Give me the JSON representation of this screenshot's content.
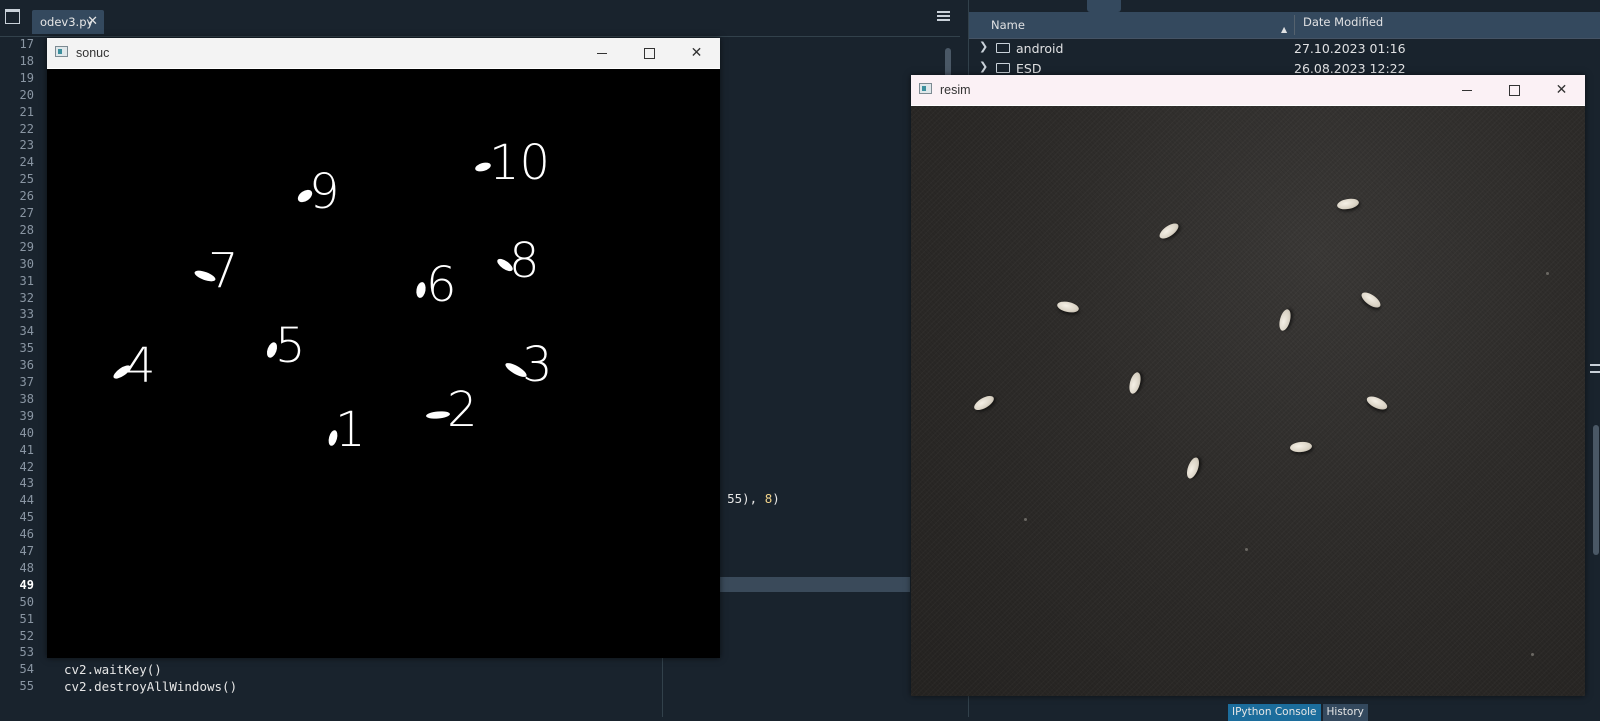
{
  "editor": {
    "tab_label": "odev3.py",
    "tab_close": "✕",
    "line_numbers": [
      "17",
      "18",
      "19",
      "20",
      "21",
      "22",
      "23",
      "24",
      "25",
      "26",
      "27",
      "28",
      "29",
      "30",
      "31",
      "32",
      "33",
      "34",
      "35",
      "36",
      "37",
      "38",
      "39",
      "40",
      "41",
      "42",
      "43",
      "44",
      "45",
      "46",
      "47",
      "48",
      "49",
      "50",
      "51",
      "52",
      "53",
      "54",
      "55"
    ],
    "current_line": "49",
    "partial_line_43_prefix": "55), ",
    "partial_line_43_num": "8",
    "partial_line_43_suffix": ")",
    "line_54": "cv2.waitKey()",
    "line_55": "cv2.destroyAllWindows()"
  },
  "files": {
    "col_name": "Name",
    "col_date": "Date Modified",
    "rows": [
      {
        "name": "android",
        "date": "27.10.2023 01:16"
      },
      {
        "name": "ESD",
        "date": "26.08.2023 12:22"
      }
    ],
    "bottom_tabs": [
      "IPython Console",
      "History"
    ]
  },
  "sonuc_window": {
    "title": "sonuc",
    "labels": [
      "1",
      "2",
      "3",
      "4",
      "5",
      "6",
      "7",
      "8",
      "9",
      "10"
    ]
  },
  "resim_window": {
    "title": "resim"
  },
  "window_buttons": {
    "minimize": "—",
    "maximize": "☐",
    "close": "✕"
  },
  "colors": {
    "background": "#19232d",
    "panel_header": "#34495e",
    "active_tab": "#1c6d9c",
    "canvas_black": "#000000"
  }
}
